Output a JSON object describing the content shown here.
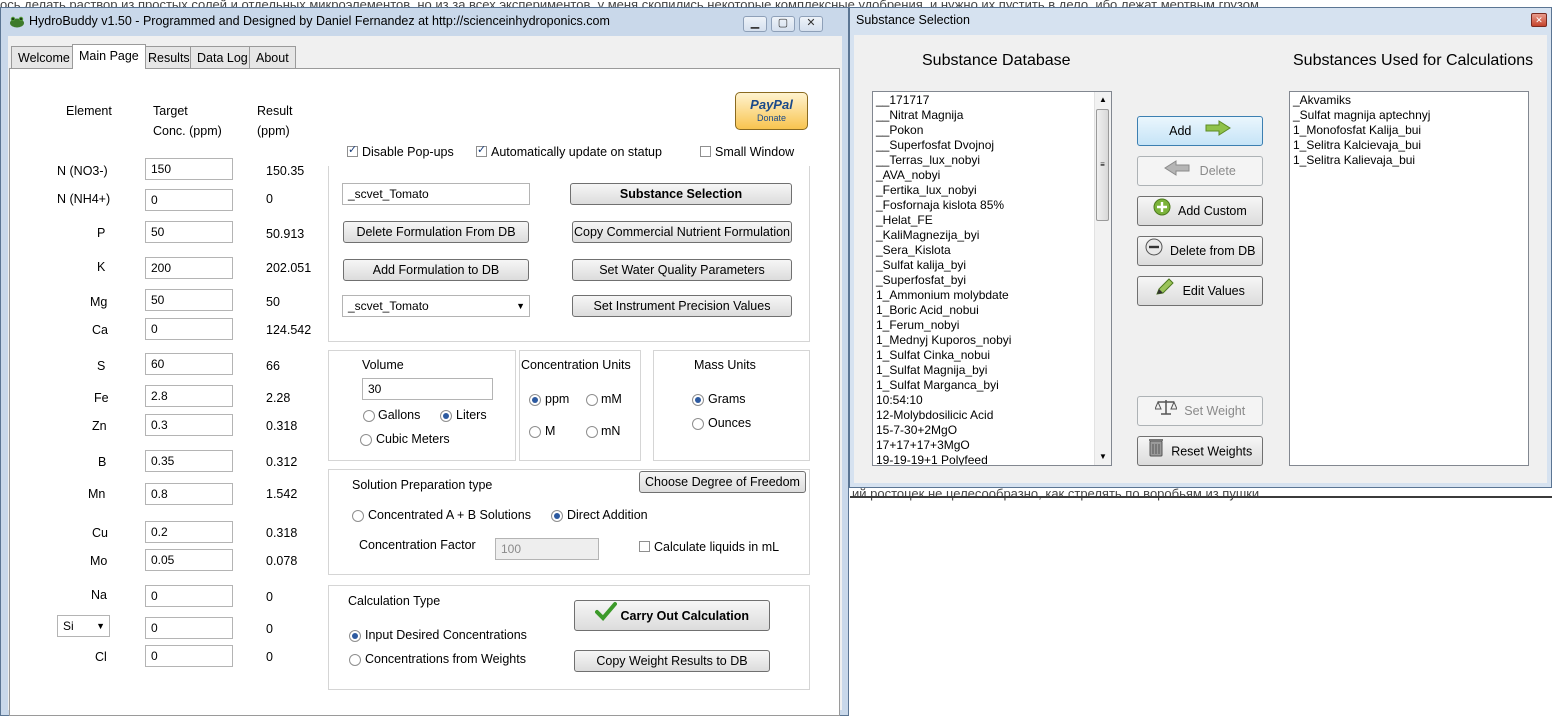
{
  "background_text": {
    "top_line": "ось делать раствор из простых солей и отдельных микроэлементов, но из за всех экспериментов, у меня скопились некоторые комплексные удобрения, и нужно их пустить в дело, ибо лежат мертвым грузом.",
    "bottom_line": "ий ростоцек не целесообразно, как стрелять по воробьям из пушки"
  },
  "main_window": {
    "title": "HydroBuddy v1.50 - Programmed and Designed by Daniel Fernandez at http://scienceinhydroponics.com",
    "tabs": [
      "Welcome",
      "Main Page",
      "Results",
      "Data Log",
      "About"
    ],
    "active_tab": "Main Page",
    "headers": {
      "element": "Element",
      "target": "Target",
      "target_sub": "Conc. (ppm)",
      "result": "Result",
      "result_sub": "(ppm)"
    },
    "elements": [
      {
        "name": "N (NO3-)",
        "target": "150",
        "result": "150.35"
      },
      {
        "name": "N (NH4+)",
        "target": "0",
        "result": "0"
      },
      {
        "name": "P",
        "target": "50",
        "result": "50.913"
      },
      {
        "name": "K",
        "target": "200",
        "result": "202.051"
      },
      {
        "name": "Mg",
        "target": "50",
        "result": "50"
      },
      {
        "name": "Ca",
        "target": "0",
        "result": "124.542"
      },
      {
        "name": "S",
        "target": "60",
        "result": "66"
      },
      {
        "name": "Fe",
        "target": "2.8",
        "result": "2.28"
      },
      {
        "name": "Zn",
        "target": "0.3",
        "result": "0.318"
      },
      {
        "name": "B",
        "target": "0.35",
        "result": "0.312"
      },
      {
        "name": "Mn",
        "target": "0.8",
        "result": "1.542"
      },
      {
        "name": "Cu",
        "target": "0.2",
        "result": "0.318"
      },
      {
        "name": "Mo",
        "target": "0.05",
        "result": "0.078"
      },
      {
        "name": "Na",
        "target": "0",
        "result": "0"
      },
      {
        "name": "Si",
        "target": "0",
        "result": "0"
      },
      {
        "name": "Cl",
        "target": "0",
        "result": "0"
      }
    ],
    "si_select": "Si",
    "paypal": {
      "brand": "PayPal",
      "action": "Donate"
    },
    "options": {
      "disable_popups": "Disable Pop-ups",
      "auto_update": "Automatically update on statup",
      "small_window": "Small Window"
    },
    "formulation_name": "_scvet_Tomato",
    "formulation_select": "_scvet_Tomato",
    "buttons": {
      "substance_selection": "Substance Selection",
      "delete_formulation": "Delete Formulation From DB",
      "copy_commercial": "Copy Commercial Nutrient Formulation",
      "add_formulation": "Add Formulation to DB",
      "water_quality": "Set Water Quality Parameters",
      "instrument_precision": "Set Instrument Precision Values",
      "degree_of_freedom": "Choose Degree of Freedom",
      "carry_out": "Carry Out Calculation",
      "copy_weight": "Copy Weight Results to DB"
    },
    "volume": {
      "label": "Volume",
      "value": "30",
      "gallons": "Gallons",
      "liters": "Liters",
      "cubic_meters": "Cubic Meters"
    },
    "conc_units": {
      "label": "Concentration Units",
      "ppm": "ppm",
      "mM": "mM",
      "M": "M",
      "mN": "mN"
    },
    "mass_units": {
      "label": "Mass Units",
      "grams": "Grams",
      "ounces": "Ounces"
    },
    "solution_prep": {
      "label": "Solution Preparation type",
      "ab": "Concentrated A + B Solutions",
      "direct": "Direct Addition"
    },
    "conc_factor": {
      "label": "Concentration Factor",
      "value": "100"
    },
    "calc_liquids": "Calculate liquids in mL",
    "calc_type": {
      "label": "Calculation Type",
      "input_desired": "Input Desired Concentrations",
      "from_weights": "Concentrations from  Weights"
    }
  },
  "substance_window": {
    "title": "Substance Selection",
    "db_heading": "Substance Database",
    "used_heading": "Substances Used for Calculations",
    "database": [
      "__171717",
      "__Nitrat Magnija",
      "__Pokon",
      "__Superfosfat Dvojnoj",
      "__Terras_lux_nobyi",
      "_AVA_nobyi",
      "_Fertika_lux_nobyi",
      "_Fosfornaja kislota 85%",
      "_Helat_FE",
      "_KaliMagnezija_byi",
      "_Sera_Kislota",
      "_Sulfat kalija_byi",
      "_Superfosfat_byi",
      "1_Ammonium molybdate",
      "1_Boric Acid_nobui",
      "1_Ferum_nobyi",
      "1_Mednyj Kuporos_nobyi",
      "1_Sulfat Cinka_nobui",
      "1_Sulfat Magnija_byi",
      "1_Sulfat Marganca_byi",
      "10:54:10",
      "12-Molybdosilicic Acid",
      "15-7-30+2MgO",
      "17+17+17+3MgO",
      "19-19-19+1 Polyfeed"
    ],
    "used": [
      "_Akvamiks",
      "_Sulfat magnija aptechnyj",
      "1_Monofosfat Kalija_bui",
      "1_Selitra Kalcievaja_bui",
      "1_Selitra Kalievaja_bui"
    ],
    "buttons": {
      "add": "Add",
      "delete": "Delete",
      "add_custom": "Add Custom",
      "delete_db": "Delete from DB",
      "edit": "Edit Values",
      "set_weight": "Set Weight",
      "reset_weights": "Reset Weights"
    }
  }
}
